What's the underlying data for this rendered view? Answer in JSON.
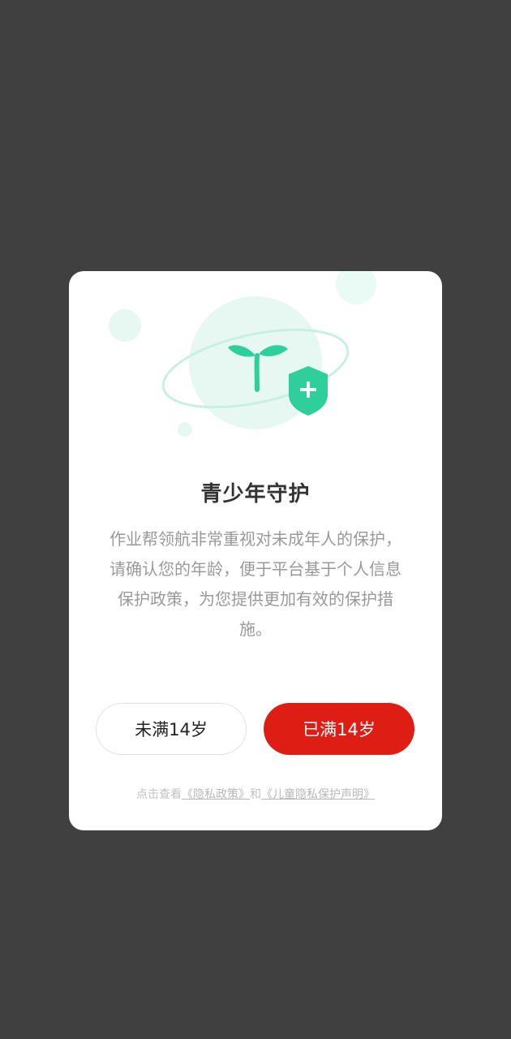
{
  "dialog": {
    "title": "青少年守护",
    "description": "作业帮领航非常重视对未成年人的保护，请确认您的年龄，便于平台基于个人信息保护政策，为您提供更加有效的保护措施。",
    "buttons": {
      "under_age": "未满14岁",
      "over_age": "已满14岁"
    },
    "footer": {
      "prefix": "点击查看",
      "privacy_link": "《隐私政策》",
      "conjunction": "和",
      "children_link": "《儿童隐私保护声明》"
    }
  },
  "colors": {
    "overlay": "#404040",
    "primary_red": "#de1e14",
    "accent_green": "#2ecf9a",
    "light_green": "#e6f8f1"
  },
  "icons": {
    "sprout": "sprout-icon",
    "shield": "shield-plus-icon"
  }
}
